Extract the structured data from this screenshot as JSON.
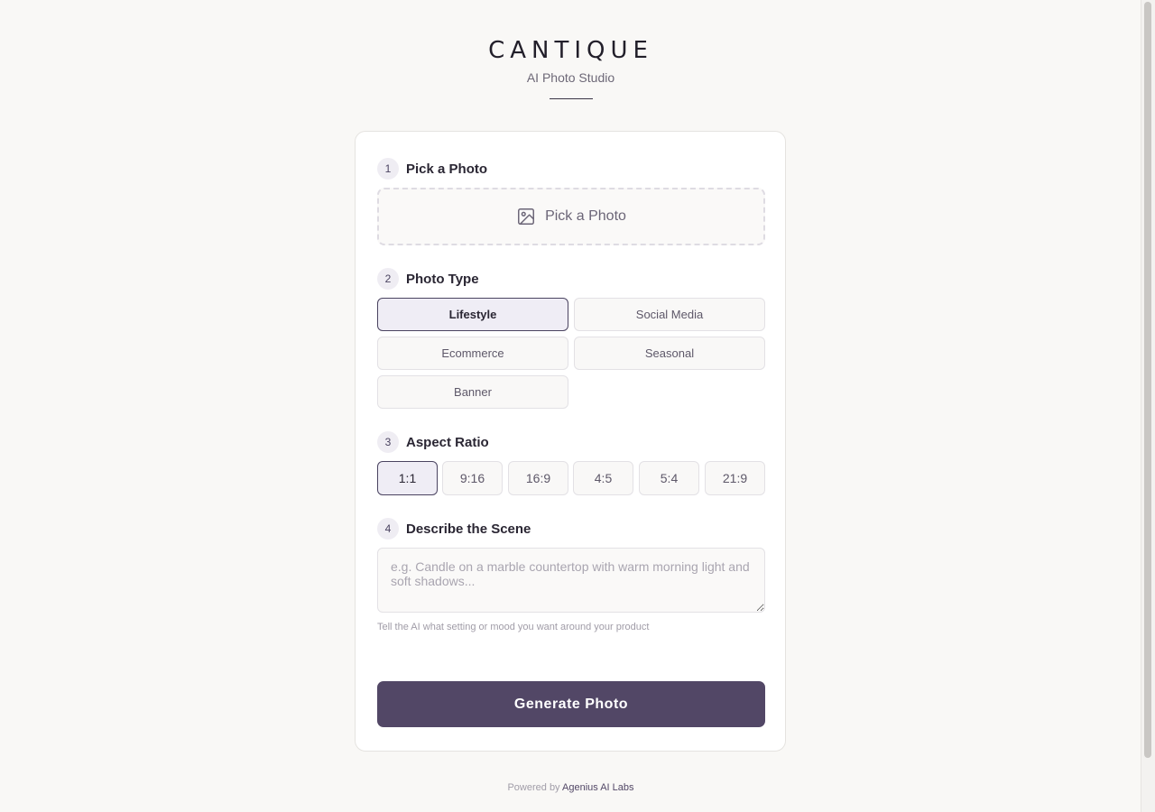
{
  "header": {
    "brand": "CANTIQUE",
    "subtitle": "AI Photo Studio"
  },
  "sections": {
    "pick_photo": {
      "number": "1",
      "title": "Pick a Photo",
      "upload_label": "Pick a Photo",
      "icon": "image-icon"
    },
    "photo_type": {
      "number": "2",
      "title": "Photo Type",
      "options": [
        "Lifestyle",
        "Social Media",
        "Ecommerce",
        "Seasonal",
        "Banner"
      ],
      "selected": "Lifestyle"
    },
    "aspect_ratio": {
      "number": "3",
      "title": "Aspect Ratio",
      "options": [
        "1:1",
        "9:16",
        "16:9",
        "4:5",
        "5:4",
        "21:9"
      ],
      "selected": "1:1"
    },
    "scene": {
      "number": "4",
      "title": "Describe the Scene",
      "placeholder": "e.g. Candle on a marble countertop with warm morning light and soft shadows...",
      "value": "",
      "hint": "Tell the AI what setting or mood you want around your product"
    }
  },
  "generate_label": "Generate Photo",
  "footer": {
    "prefix": "Powered by",
    "link": "Agenius AI Labs"
  },
  "colors": {
    "accent": "#524766",
    "background": "#f9f8f6",
    "card": "#ffffff"
  }
}
